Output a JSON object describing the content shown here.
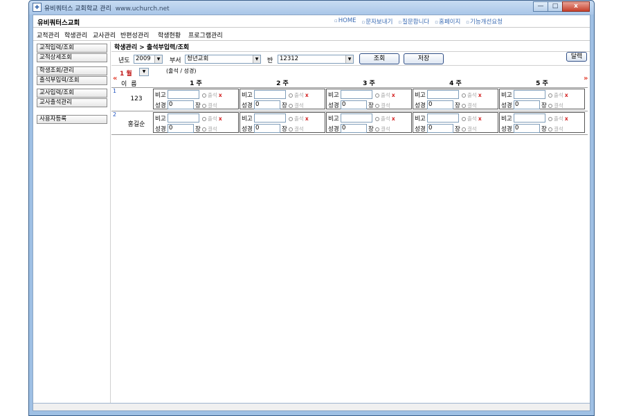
{
  "window": {
    "title": "유비쿼터스 교회학교 관리",
    "url": "www.uchurch.net",
    "buttons": {
      "minimize": "—",
      "maximize": "□",
      "close": "x"
    }
  },
  "app": {
    "title": "유비쿼터스교회",
    "top_links": [
      "HOME",
      "문자보내기",
      "질문합니다",
      "홈페이지",
      "기능개선요청"
    ]
  },
  "menu": [
    "교적관리",
    "학생관리",
    "교사관리",
    "반편성관리",
    "학생현황",
    "프로그램관리"
  ],
  "sidebar": [
    "교적입력/조회",
    "교적상세조회",
    "학생조회/관리",
    "출석부입력/조회",
    "교사입력/조회",
    "교사출석관리",
    "사용자등록"
  ],
  "page": {
    "heading": "학생관리 > 출석부입력/조회",
    "filters": {
      "year_label": "년도",
      "year_value": "2009",
      "dept_label": "부서",
      "dept_value": "청년교회",
      "class_label": "반",
      "class_value": "12312"
    },
    "search_button": "조회",
    "save_button": "저장",
    "print_button": "달력"
  },
  "grid": {
    "prev_arrow": "«",
    "next_arrow": "»",
    "month_label": "1 월",
    "attendance_note": "(출석 / 성경)",
    "name_header": "이름",
    "weeks": [
      "1 주",
      "2 주",
      "3 주",
      "4 주",
      "5 주"
    ],
    "cell_labels": {
      "note": "비고",
      "bible": "성경",
      "chapter": "장",
      "present": "출석",
      "absent": "결석",
      "x_mark": "x"
    },
    "students": [
      {
        "num": "1",
        "name": "123",
        "bible_values": [
          "0",
          "0",
          "0",
          "0",
          "0"
        ]
      },
      {
        "num": "2",
        "name": "홍길순",
        "bible_values": [
          "0",
          "0",
          "0",
          "0",
          "0"
        ]
      }
    ]
  }
}
